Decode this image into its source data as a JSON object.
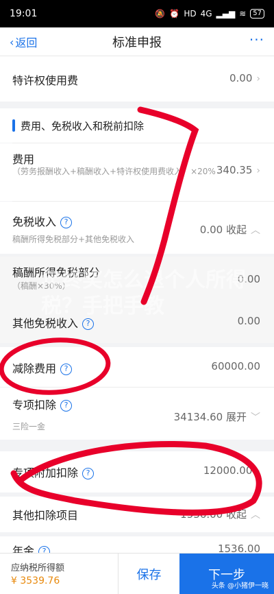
{
  "status": {
    "time": "19:01",
    "hd": "HD",
    "net": "4G",
    "battery": "57"
  },
  "nav": {
    "back_label": "返回",
    "title": "标准申报",
    "more": "···"
  },
  "rows": {
    "franchise": {
      "label": "特许权使用费",
      "value": "0.00"
    },
    "section": {
      "title": "费用、免税收入和税前扣除"
    },
    "expense": {
      "label": "费用",
      "sub": "（劳务报酬收入+稿酬收入+特许权使用费收入）×20%",
      "value": "340.35"
    },
    "tax_free": {
      "label": "免税收入",
      "sub": "稿酬所得免税部分+其他免税收入",
      "value": "0.00",
      "action": "收起"
    },
    "royalty_free": {
      "label": "稿酬所得免税部分",
      "sub": "（稿酬×30%）",
      "value": "0.00"
    },
    "other_free": {
      "label": "其他免税收入",
      "value": "0.00"
    },
    "deduct_fee": {
      "label": "减除费用",
      "value": "60000.00"
    },
    "special": {
      "label": "专项扣除",
      "sub": "三险一金",
      "value": "34134.60",
      "action": "展开"
    },
    "special_add": {
      "label": "专项附加扣除",
      "value": "12000.00"
    },
    "other_deduct": {
      "label": "其他扣除项目",
      "value": "1536.00",
      "action": "收起"
    },
    "annuity": {
      "label": "年金",
      "value": "1536.00"
    }
  },
  "bottom": {
    "tax_label": "应纳税所得额",
    "tax_value": "¥ 3539.76",
    "save": "保存",
    "next": "下一步",
    "watermark": "头条 @小猪伊一晓"
  },
  "overlay": {
    "text": "年终奖怎么退个人所得税？手把手教"
  },
  "colors": {
    "accent": "#1a72e8",
    "scribble": "#e8002a",
    "tax_value": "#e8890c"
  }
}
